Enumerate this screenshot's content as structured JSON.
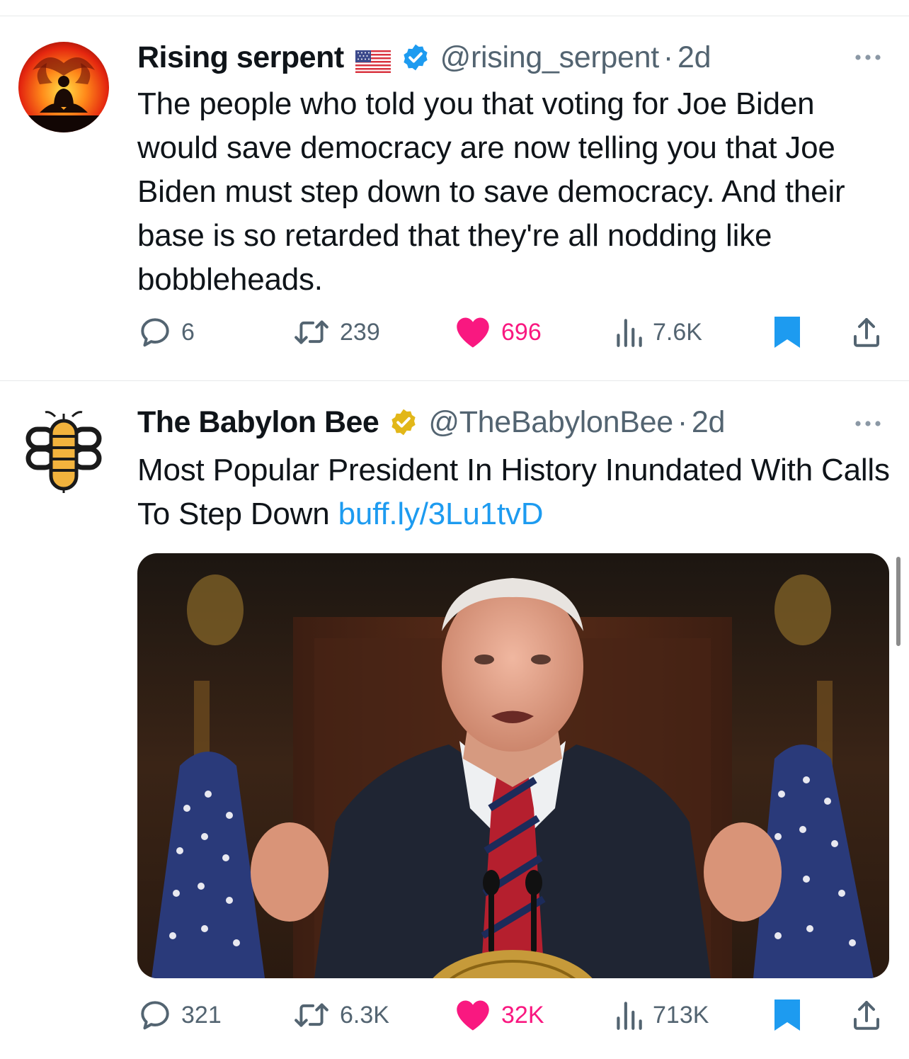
{
  "tweets": [
    {
      "display_name": "Rising serpent",
      "handle": "@rising_serpent",
      "separator": "·",
      "time": "2d",
      "text": "The people who told you that voting for Joe Biden would save democracy are now telling you that Joe Biden must step down to save democracy. And their base is so retarded that they're all nodding like bobbleheads.",
      "link": "",
      "verified_badge": "blue-check-icon",
      "flag": "us-flag-icon",
      "stats": {
        "replies": "6",
        "reposts": "239",
        "likes": "696",
        "views": "7.6K"
      }
    },
    {
      "display_name": "The Babylon Bee",
      "handle": "@TheBabylonBee",
      "separator": "·",
      "time": "2d",
      "text": "Most Popular President In History Inundated With Calls To Step Down ",
      "link": "buff.ly/3Lu1tvD",
      "verified_badge": "gold-check-icon",
      "stats": {
        "replies": "321",
        "reposts": "6.3K",
        "likes": "32K",
        "views": "713K"
      }
    }
  ],
  "colors": {
    "text_primary": "#0f1419",
    "text_secondary": "#536471",
    "link": "#1d9bf0",
    "like": "#f91880",
    "bookmark": "#1d9bf0",
    "verified_blue": "#1d9bf0",
    "verified_gold": "#e2b719"
  }
}
